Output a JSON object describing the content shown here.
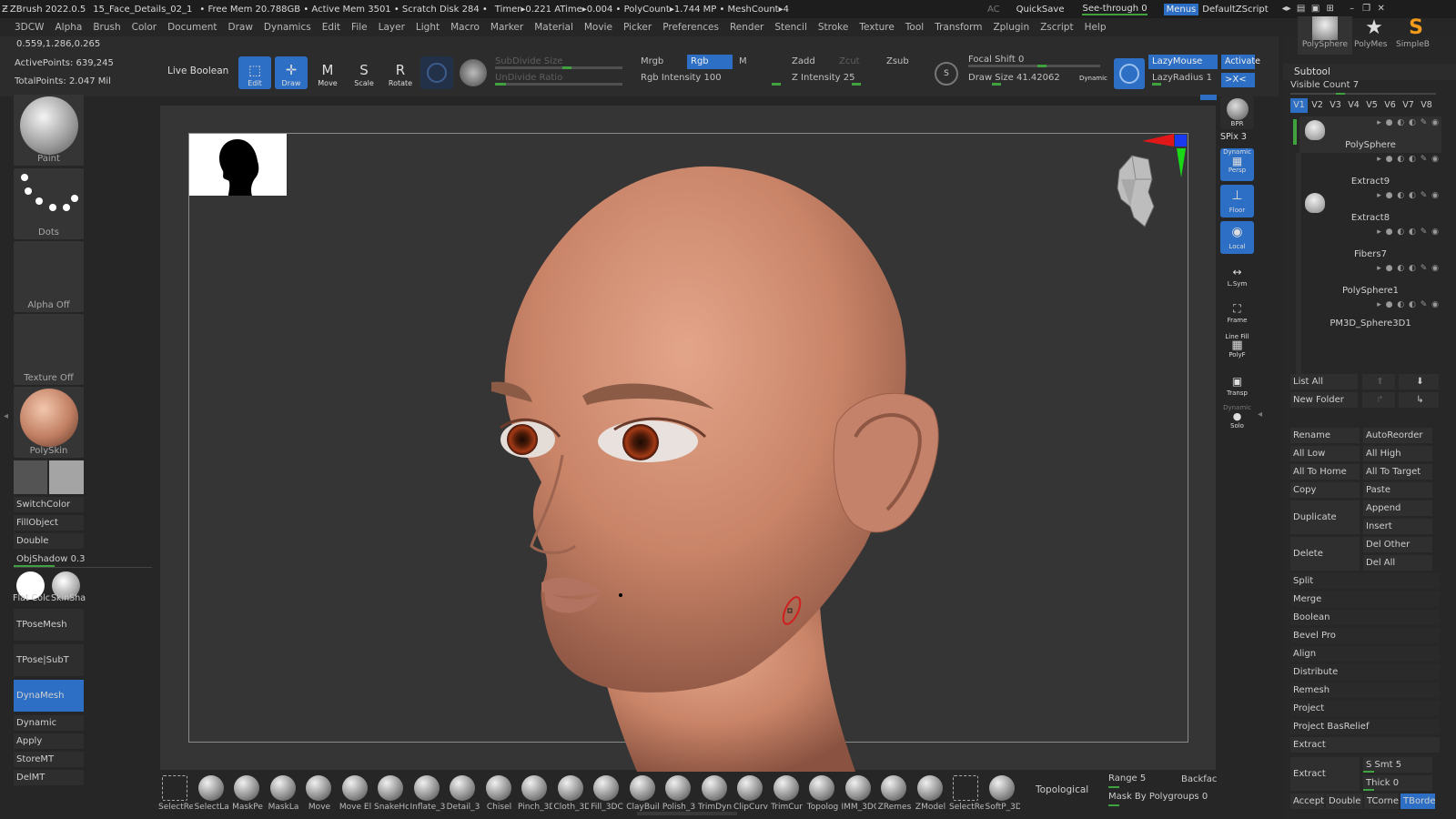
{
  "titlebar": {
    "app": "ZBrush 2022.0.5",
    "file": "15_Face_Details_02_1",
    "mem": "• Free Mem 20.788GB • Active Mem 3501 • Scratch Disk 284 •",
    "timer": "Timer▸0.221 ATime▸0.004 • PolyCount▸1.744 MP • MeshCount▸4",
    "ac": "AC",
    "quicksave": "QuickSave",
    "seethrough": "See-through  0",
    "menus": "Menus",
    "script": "DefaultZScript"
  },
  "menus": [
    "3DCW",
    "Alpha",
    "Brush",
    "Color",
    "Document",
    "Draw",
    "Dynamics",
    "Edit",
    "File",
    "Layer",
    "Light",
    "Macro",
    "Marker",
    "Material",
    "Movie",
    "Picker",
    "Preferences",
    "Render",
    "Stencil",
    "Stroke",
    "Texture",
    "Tool",
    "Transform",
    "Zplugin",
    "Zscript",
    "Help"
  ],
  "info": {
    "coords": "0.559,1.286,0.265",
    "active_points": "ActivePoints: 639,245",
    "total_points": "TotalPoints: 2.047 Mil"
  },
  "toolbar": {
    "live_boolean": "Live Boolean",
    "edit": "Edit",
    "draw": "Draw",
    "move": "Move",
    "scale": "Scale",
    "rotate": "Rotate",
    "subdivide": "SubDivide Size",
    "undivide": "UnDivide Ratio",
    "mrgb": "Mrgb",
    "rgb": "Rgb",
    "m": "M",
    "rgb_intensity": "Rgb Intensity 100",
    "zadd": "Zadd",
    "zcut": "Zcut",
    "zsub": "Zsub",
    "z_intensity": "Z Intensity 25",
    "focal_shift": "Focal Shift 0",
    "draw_size": "Draw Size 41.42062",
    "dynamic": "Dynamic",
    "lazymouse": "LazyMouse",
    "lazyradius": "LazyRadius 1",
    "activate": "Activate",
    "xcx": ">X<"
  },
  "left": {
    "paint": "Paint",
    "dots": "Dots",
    "alpha_off": "Alpha Off",
    "texture_off": "Texture Off",
    "polyskin": "PolySkin",
    "switchcolor": "SwitchColor",
    "fillobject": "FillObject",
    "double": "Double",
    "objshadow": "ObjShadow 0.3",
    "flatcolor": "Flat Colc",
    "skinshade": "SkinSha",
    "tposemesh": "TPoseMesh",
    "tposesubt": "TPose|SubT",
    "dynamesh": "DynaMesh",
    "dynamic": "Dynamic",
    "apply": "Apply",
    "storemt": "StoreMT",
    "delmt": "DelMT",
    "objshadow_level": 0.3
  },
  "rightbar": {
    "bpr": "BPR",
    "spix": "SPix 3",
    "persp": "Persp",
    "dynamic": "Dynamic",
    "floor": "Floor",
    "local": "Local",
    "lsym": "L.Sym",
    "frame": "Frame",
    "linefill": "Line Fill",
    "polyf": "PolyF",
    "transp": "Transp",
    "dynamic2": "Dynamic",
    "solo": "Solo"
  },
  "subtool": {
    "tools": [
      "PolySphere",
      "PolyMes",
      "SimpleB"
    ],
    "title": "Subtool",
    "visible_count": "Visible Count 7",
    "versions": [
      "V1",
      "V2",
      "V3",
      "V4",
      "V5",
      "V6",
      "V7",
      "V8"
    ],
    "items": [
      "PolySphere",
      "Extract9",
      "Extract8",
      "Fibers7",
      "PolySphere1",
      "PM3D_Sphere3D1"
    ],
    "list_all": "List All",
    "new_folder": "New Folder",
    "rename": "Rename",
    "autoreorder": "AutoReorder",
    "all_low": "All Low",
    "all_high": "All High",
    "all_to_home": "All To Home",
    "all_to_target": "All To Target",
    "copy": "Copy",
    "paste": "Paste",
    "duplicate": "Duplicate",
    "append": "Append",
    "insert": "Insert",
    "delete": "Delete",
    "del_other": "Del Other",
    "del_all": "Del All",
    "split": "Split",
    "merge": "Merge",
    "boolean": "Boolean",
    "bevel_pro": "Bevel Pro",
    "align": "Align",
    "distribute": "Distribute",
    "remesh": "Remesh",
    "project": "Project",
    "project_basrelief": "Project BasRelief",
    "extract_section": "Extract",
    "extract": "Extract",
    "s_smt": "S Smt 5",
    "thick": "Thick 0",
    "accept": "Accept",
    "double": "Double",
    "tcorne": "TCorne",
    "tborde": "TBorde"
  },
  "bottom": {
    "brushes": [
      "SelectRe",
      "SelectLa",
      "MaskPe",
      "MaskLa",
      "Move",
      "Move El",
      "SnakeHo",
      "Inflate_3",
      "Detail_3",
      "Chisel",
      "Pinch_3D",
      "Cloth_3D",
      "Fill_3DC",
      "ClayBuil",
      "Polish_3",
      "TrimDyn",
      "ClipCurv",
      "TrimCur",
      "Topolog",
      "IMM_3DC",
      "ZRemes",
      "ZModel",
      "SelectRe",
      "SoftP_3D"
    ],
    "topological": "Topological",
    "range": "Range 5",
    "backface": "Backfac",
    "mask_by_polygroups": "Mask By Polygroups 0"
  },
  "colors": {
    "accent": "#2d6fc4",
    "skin": "#c9886a",
    "green": "#3fa23f"
  }
}
